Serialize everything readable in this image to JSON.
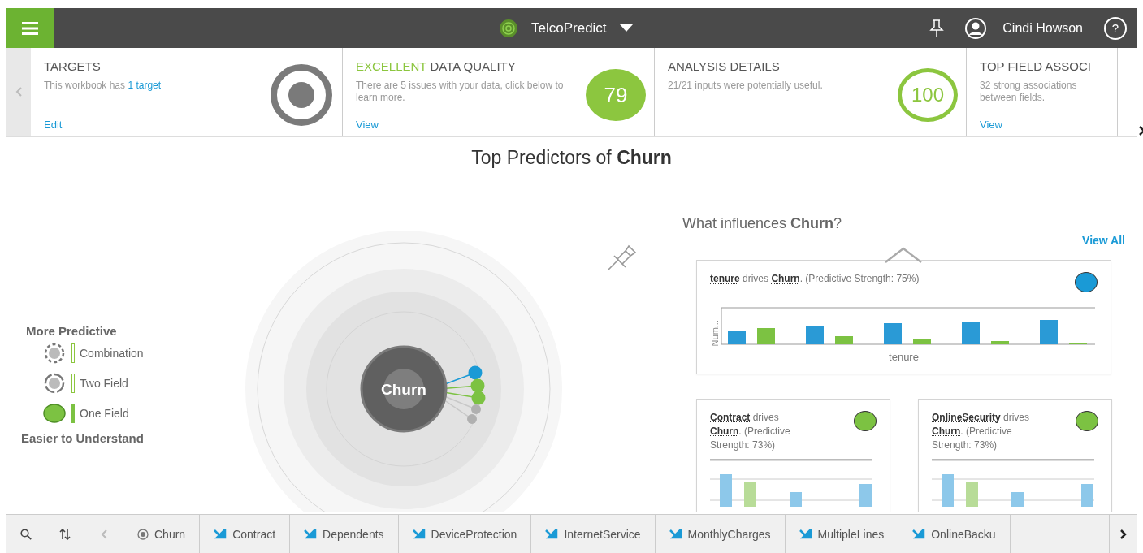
{
  "header": {
    "app_name": "TelcoPredict",
    "user_name": "Cindi Howson",
    "help_label": "?"
  },
  "summary_cards": [
    {
      "kind": "target",
      "title": "TARGETS",
      "text": "This workbook has",
      "text_link": "1 target",
      "action": "Edit"
    },
    {
      "kind": "score",
      "title_highlight": "EXCELLENT",
      "title": "DATA QUALITY",
      "text": "There are 5 issues with your data, click below to learn more.",
      "score": "79",
      "action": "View"
    },
    {
      "kind": "ring",
      "title": "ANALYSIS DETAILS",
      "text": "21/21 inputs were potentially useful.",
      "score": "100"
    },
    {
      "kind": "plain",
      "title": "TOP FIELD ASSOCI",
      "text": "32 strong associations between fields.",
      "action": "View"
    }
  ],
  "main_title": "Top Predictors of **Churn**",
  "legend": {
    "top_label": "More Predictive",
    "bottom_label": "Easier to Understand",
    "items": [
      {
        "kind": "combination",
        "label": "Combination"
      },
      {
        "kind": "two_field",
        "label": "Two Field"
      },
      {
        "kind": "one_field",
        "label": "One Field"
      }
    ]
  },
  "diagram": {
    "center_label": "Churn",
    "predictors": [
      {
        "color": "#1a9ad6"
      },
      {
        "color": "#7cc242"
      },
      {
        "color": "#7cc242"
      },
      {
        "color": "#b0b0b0"
      },
      {
        "color": "#b0b0b0"
      }
    ]
  },
  "influences": {
    "title": "What influences **Churn**?",
    "view_all": "View All",
    "cards": [
      {
        "text": "**tenure** drives **Churn**. (Predictive Strength: 75%)",
        "color": "#1a9ad6",
        "ylabel": "Num...",
        "xlabel": "tenure"
      },
      {
        "text": "**Contract** drives **Churn**. (Predictive Strength: 73%)",
        "color": "#7cc242"
      },
      {
        "text": "**OnlineSecurity** drives **Churn**. (Predictive Strength: 73%)",
        "color": "#7cc242"
      }
    ]
  },
  "field_tabs": [
    {
      "kind": "target",
      "label": "Churn"
    },
    {
      "kind": "field",
      "label": "Contract"
    },
    {
      "kind": "field",
      "label": "Dependents"
    },
    {
      "kind": "field",
      "label": "DeviceProtection"
    },
    {
      "kind": "field",
      "label": "InternetService"
    },
    {
      "kind": "field",
      "label": "MonthlyCharges"
    },
    {
      "kind": "field",
      "label": "MultipleLines"
    },
    {
      "kind": "field",
      "label": "OnlineBacku"
    }
  ]
}
